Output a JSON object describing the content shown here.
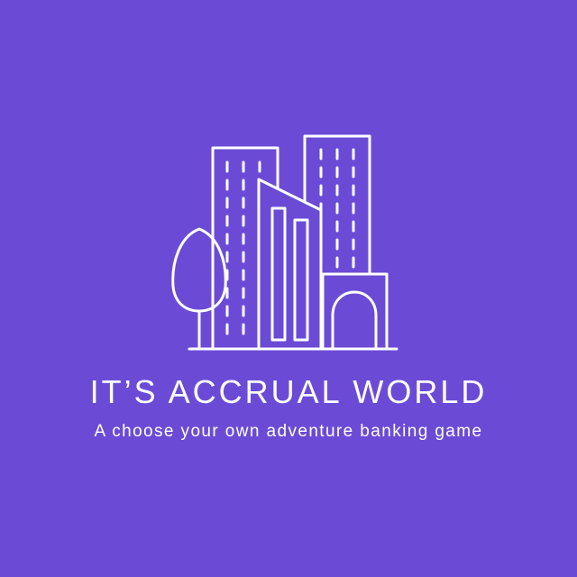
{
  "brand": {
    "title": "IT’S ACCRUAL WORLD",
    "tagline": "A choose your own adventure banking game",
    "logo_icon": "city-buildings-icon"
  },
  "colors": {
    "background": "#6b4bd6",
    "foreground": "#ffffff"
  }
}
